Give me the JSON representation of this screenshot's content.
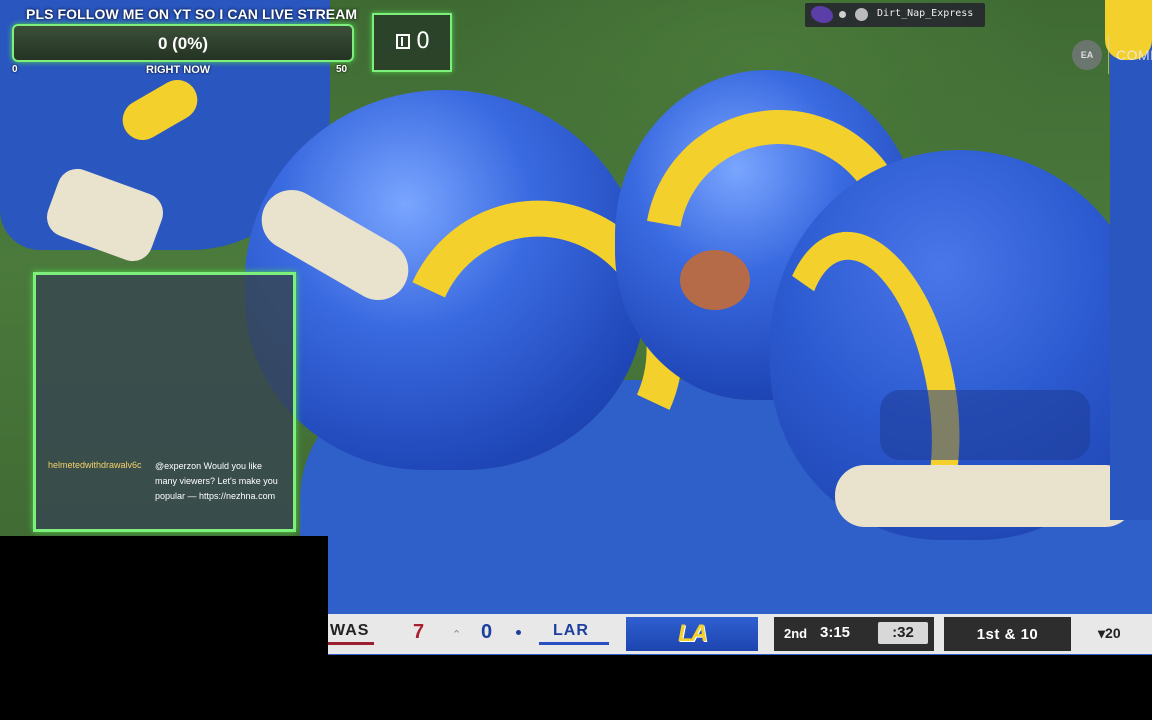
{
  "stream_goal": {
    "title": "PLS FOLLOW ME ON YT SO I CAN LIVE STREAM",
    "value": "0 (0%)",
    "min": "0",
    "max": "50",
    "period": "RIGHT NOW",
    "progress_fraction": 0.0
  },
  "viewers": {
    "count": "0",
    "icon": "viewer-icon"
  },
  "player_badge": {
    "username": "Dirt_Nap_Express"
  },
  "ea": {
    "logo_text": "EA",
    "mode": "COMP"
  },
  "chat": {
    "username": "helmetedwithdrawalv6c",
    "message": "@experzon Would you like many viewers? Let's make you popular — https://nezhna.com"
  },
  "scoreboard": {
    "away_team": "WAS",
    "away_score": "7",
    "home_score": "0",
    "home_team": "LAR",
    "home_logo_text": "LA",
    "quarter": "2nd",
    "game_clock": "3:15",
    "play_clock": ":32",
    "down_distance": "1st & 10",
    "yard_line": "▾20",
    "colors": {
      "away": "#a8202f",
      "home": "#1d3f9e",
      "accent_green": "#7cf07a"
    }
  }
}
